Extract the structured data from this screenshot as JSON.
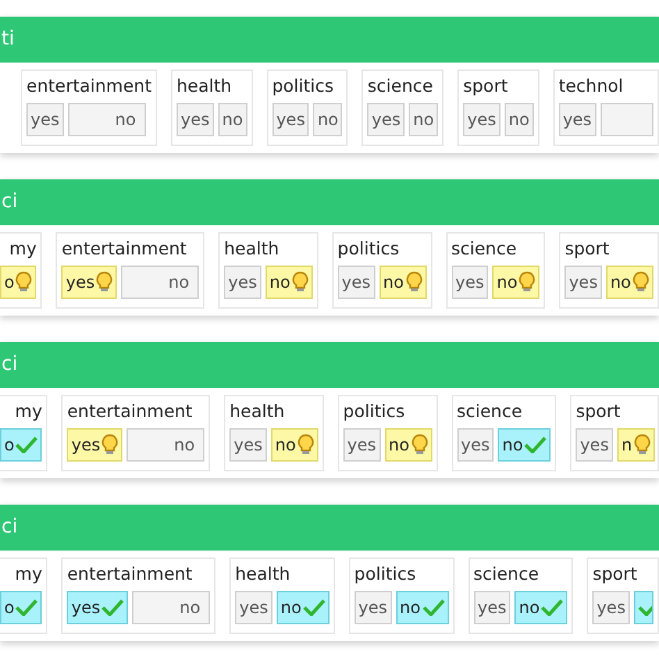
{
  "panels": [
    {
      "header": "ti",
      "groups": [
        {
          "label": "entertainment",
          "yes": {
            "text": "yes",
            "suggested": false,
            "confirmed": false
          },
          "no": {
            "text": "no",
            "suggested": false,
            "confirmed": false,
            "wide": true
          }
        },
        {
          "label": "health",
          "yes": {
            "text": "yes",
            "suggested": false,
            "confirmed": false
          },
          "no": {
            "text": "no",
            "suggested": false,
            "confirmed": false
          }
        },
        {
          "label": "politics",
          "yes": {
            "text": "yes",
            "suggested": false,
            "confirmed": false
          },
          "no": {
            "text": "no",
            "suggested": false,
            "confirmed": false
          }
        },
        {
          "label": "science",
          "yes": {
            "text": "yes",
            "suggested": false,
            "confirmed": false
          },
          "no": {
            "text": "no",
            "suggested": false,
            "confirmed": false
          }
        },
        {
          "label": "sport",
          "yes": {
            "text": "yes",
            "suggested": false,
            "confirmed": false
          },
          "no": {
            "text": "no",
            "suggested": false,
            "confirmed": false
          }
        },
        {
          "label": "technol",
          "yes": {
            "text": "yes",
            "suggested": false,
            "confirmed": false
          },
          "no": {
            "suggested": false,
            "confirmed": false,
            "wide": true
          }
        }
      ]
    },
    {
      "header": "ci",
      "groups": [
        {
          "label": "my",
          "cut_left": true,
          "no": {
            "text": "o",
            "suggested": true,
            "confirmed": false
          }
        },
        {
          "label": "entertainment",
          "yes": {
            "text": "yes",
            "suggested": true,
            "confirmed": false
          },
          "no": {
            "text": "no",
            "suggested": false,
            "confirmed": false,
            "wide": true
          }
        },
        {
          "label": "health",
          "yes": {
            "text": "yes",
            "suggested": false,
            "confirmed": false
          },
          "no": {
            "text": "no",
            "suggested": true,
            "confirmed": false
          }
        },
        {
          "label": "politics",
          "yes": {
            "text": "yes",
            "suggested": false,
            "confirmed": false
          },
          "no": {
            "text": "no",
            "suggested": true,
            "confirmed": false
          }
        },
        {
          "label": "science",
          "yes": {
            "text": "yes",
            "suggested": false,
            "confirmed": false
          },
          "no": {
            "text": "no",
            "suggested": true,
            "confirmed": false
          }
        },
        {
          "label": "sport",
          "yes": {
            "text": "yes",
            "suggested": false,
            "confirmed": false
          },
          "no": {
            "text": "no",
            "suggested": true,
            "confirmed": false
          }
        }
      ]
    },
    {
      "header": "ci",
      "groups": [
        {
          "label": "my",
          "cut_left": true,
          "no": {
            "text": "o",
            "suggested": false,
            "confirmed": true
          }
        },
        {
          "label": "entertainment",
          "yes": {
            "text": "yes",
            "suggested": true,
            "confirmed": false
          },
          "no": {
            "text": "no",
            "suggested": false,
            "confirmed": false,
            "wide": true
          }
        },
        {
          "label": "health",
          "yes": {
            "text": "yes",
            "suggested": false,
            "confirmed": false
          },
          "no": {
            "text": "no",
            "suggested": true,
            "confirmed": false
          }
        },
        {
          "label": "politics",
          "yes": {
            "text": "yes",
            "suggested": false,
            "confirmed": false
          },
          "no": {
            "text": "no",
            "suggested": true,
            "confirmed": false
          }
        },
        {
          "label": "science",
          "yes": {
            "text": "yes",
            "suggested": false,
            "confirmed": false
          },
          "no": {
            "text": "no",
            "suggested": false,
            "confirmed": true
          }
        },
        {
          "label": "sport",
          "yes": {
            "text": "yes",
            "suggested": false,
            "confirmed": false
          },
          "no": {
            "text": "n",
            "suggested": true,
            "confirmed": false
          }
        }
      ]
    },
    {
      "header": "ci",
      "groups": [
        {
          "label": "my",
          "cut_left": true,
          "no": {
            "text": "o",
            "suggested": false,
            "confirmed": true
          }
        },
        {
          "label": "entertainment",
          "yes": {
            "text": "yes",
            "suggested": false,
            "confirmed": true
          },
          "no": {
            "text": "no",
            "suggested": false,
            "confirmed": false,
            "wide": true
          }
        },
        {
          "label": "health",
          "yes": {
            "text": "yes",
            "suggested": false,
            "confirmed": false
          },
          "no": {
            "text": "no",
            "suggested": false,
            "confirmed": true
          }
        },
        {
          "label": "politics",
          "yes": {
            "text": "yes",
            "suggested": false,
            "confirmed": false
          },
          "no": {
            "text": "no",
            "suggested": false,
            "confirmed": true
          }
        },
        {
          "label": "science",
          "yes": {
            "text": "yes",
            "suggested": false,
            "confirmed": false
          },
          "no": {
            "text": "no",
            "suggested": false,
            "confirmed": true
          }
        },
        {
          "label": "sport",
          "yes": {
            "text": "yes",
            "suggested": false,
            "confirmed": false
          },
          "no": {
            "suggested": false,
            "confirmed": true
          }
        }
      ]
    }
  ]
}
